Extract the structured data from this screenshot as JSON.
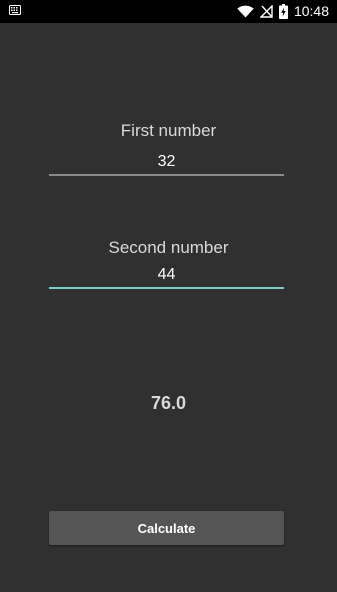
{
  "status_bar": {
    "time": "10:48",
    "icons": [
      "keyboard-icon",
      "wifi-icon",
      "no-signal-icon",
      "battery-charging-icon"
    ]
  },
  "form": {
    "first_label": "First number",
    "first_value": "32",
    "second_label": "Second number",
    "second_value": "44",
    "result": "76.0",
    "button_label": "Calculate"
  },
  "colors": {
    "background": "#303030",
    "status_bar": "#000000",
    "accent": "#80cbc4",
    "button": "#555555"
  }
}
